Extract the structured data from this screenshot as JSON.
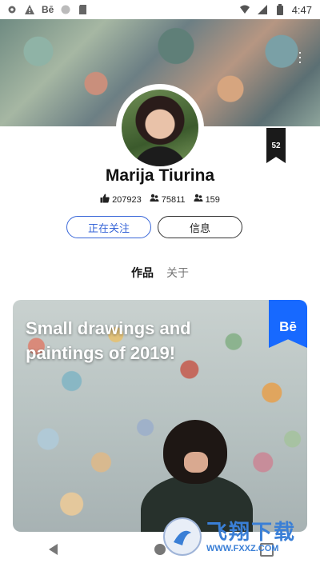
{
  "status_bar": {
    "left_icons": [
      "gear-icon",
      "warning-icon",
      "behance-icon",
      "circle-icon",
      "sd-card-icon"
    ],
    "behance_label": "Bē",
    "time": "4:47",
    "right_icons": [
      "wifi-icon",
      "signal-icon",
      "battery-icon"
    ]
  },
  "profile": {
    "name": "Marija Tiurina",
    "ribbon_count": "52",
    "stats": {
      "appreciations": "207923",
      "followers": "75811",
      "following": "159"
    },
    "follow_button": "正在关注",
    "message_button": "信息"
  },
  "tabs": {
    "works": "作品",
    "about": "关于"
  },
  "project": {
    "title": "Small drawings and paintings of 2019!",
    "badge": "Bē"
  },
  "watermark": {
    "cn": "飞翔下载",
    "url": "WWW.FXXZ.COM"
  }
}
